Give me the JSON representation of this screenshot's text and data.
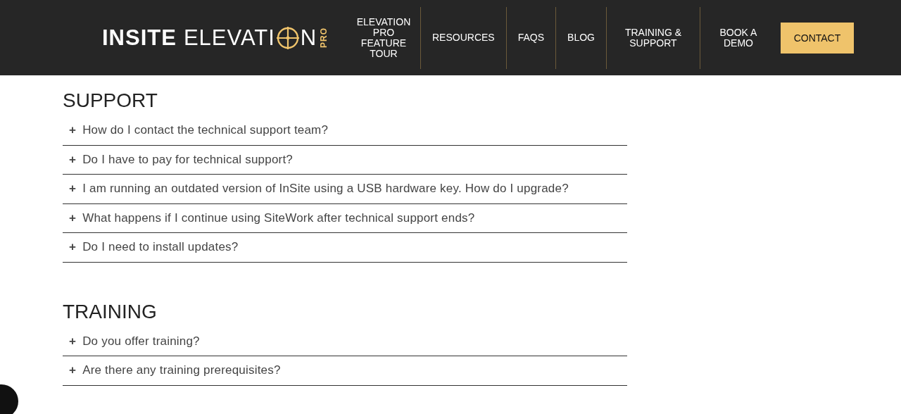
{
  "header": {
    "logo": {
      "word1": "INSITE",
      "word2": "ELEVATI",
      "word3": "N",
      "badge": "PRO"
    },
    "nav": [
      {
        "label": "ELEVATION PRO FEATURE TOUR",
        "kind": "link"
      },
      {
        "label": "RESOURCES",
        "kind": "link"
      },
      {
        "label": "FAQS",
        "kind": "link"
      },
      {
        "label": "BLOG",
        "kind": "link"
      },
      {
        "label": "TRAINING & SUPPORT",
        "kind": "link"
      },
      {
        "label": "BOOK A DEMO",
        "kind": "link"
      },
      {
        "label": "CONTACT",
        "kind": "cta"
      }
    ]
  },
  "sections": [
    {
      "title": "SUPPORT",
      "items": [
        {
          "icon": "+",
          "question": "How do I contact the technical support team?"
        },
        {
          "icon": "+",
          "question": "Do I have to pay for technical support?"
        },
        {
          "icon": "+",
          "question": "I am running an outdated version of InSite using a USB hardware key. How do I upgrade?"
        },
        {
          "icon": "+",
          "question": "What happens if I continue using SiteWork after technical support ends?"
        },
        {
          "icon": "+",
          "question": "Do I need to install updates?"
        }
      ]
    },
    {
      "title": "TRAINING",
      "items": [
        {
          "icon": "+",
          "question": "Do you offer training?"
        },
        {
          "icon": "+",
          "question": "Are there any training prerequisites?"
        }
      ]
    }
  ]
}
